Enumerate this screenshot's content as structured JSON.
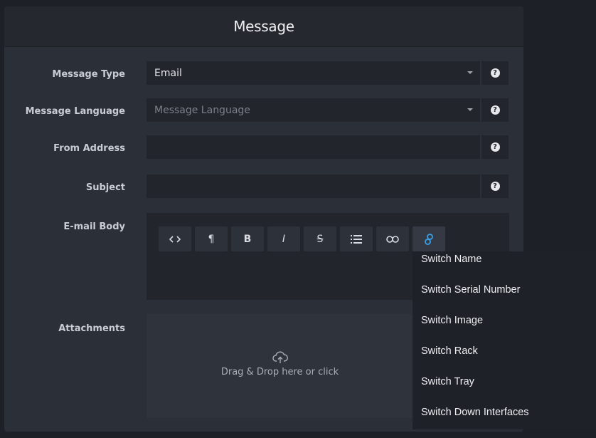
{
  "panel": {
    "title": "Message"
  },
  "form": {
    "message_type": {
      "label": "Message Type",
      "value": "Email"
    },
    "message_language": {
      "label": "Message Language",
      "placeholder": "Message Language"
    },
    "from_address": {
      "label": "From Address",
      "value": ""
    },
    "subject": {
      "label": "Subject",
      "value": ""
    },
    "email_body": {
      "label": "E-mail Body"
    },
    "attachments": {
      "label": "Attachments",
      "dropzone_text": "Drag & Drop here or click"
    }
  },
  "toolbar": {
    "buttons": [
      {
        "name": "code-view-button",
        "glyph": "<>"
      },
      {
        "name": "paragraph-button",
        "glyph": "¶"
      },
      {
        "name": "bold-button",
        "glyph": "B"
      },
      {
        "name": "italic-button",
        "glyph": "I"
      },
      {
        "name": "strikethrough-button",
        "glyph": "S"
      },
      {
        "name": "list-button",
        "glyph": "list-icon"
      },
      {
        "name": "link-button",
        "glyph": "link-icon"
      },
      {
        "name": "insert-variable-button",
        "glyph": "chain-icon"
      }
    ],
    "accent_color": "#3aa0e8"
  },
  "variable_menu": {
    "items": [
      "Switch Name",
      "Switch Serial Number",
      "Switch Image",
      "Switch Rack",
      "Switch Tray",
      "Switch Down Interfaces"
    ]
  }
}
